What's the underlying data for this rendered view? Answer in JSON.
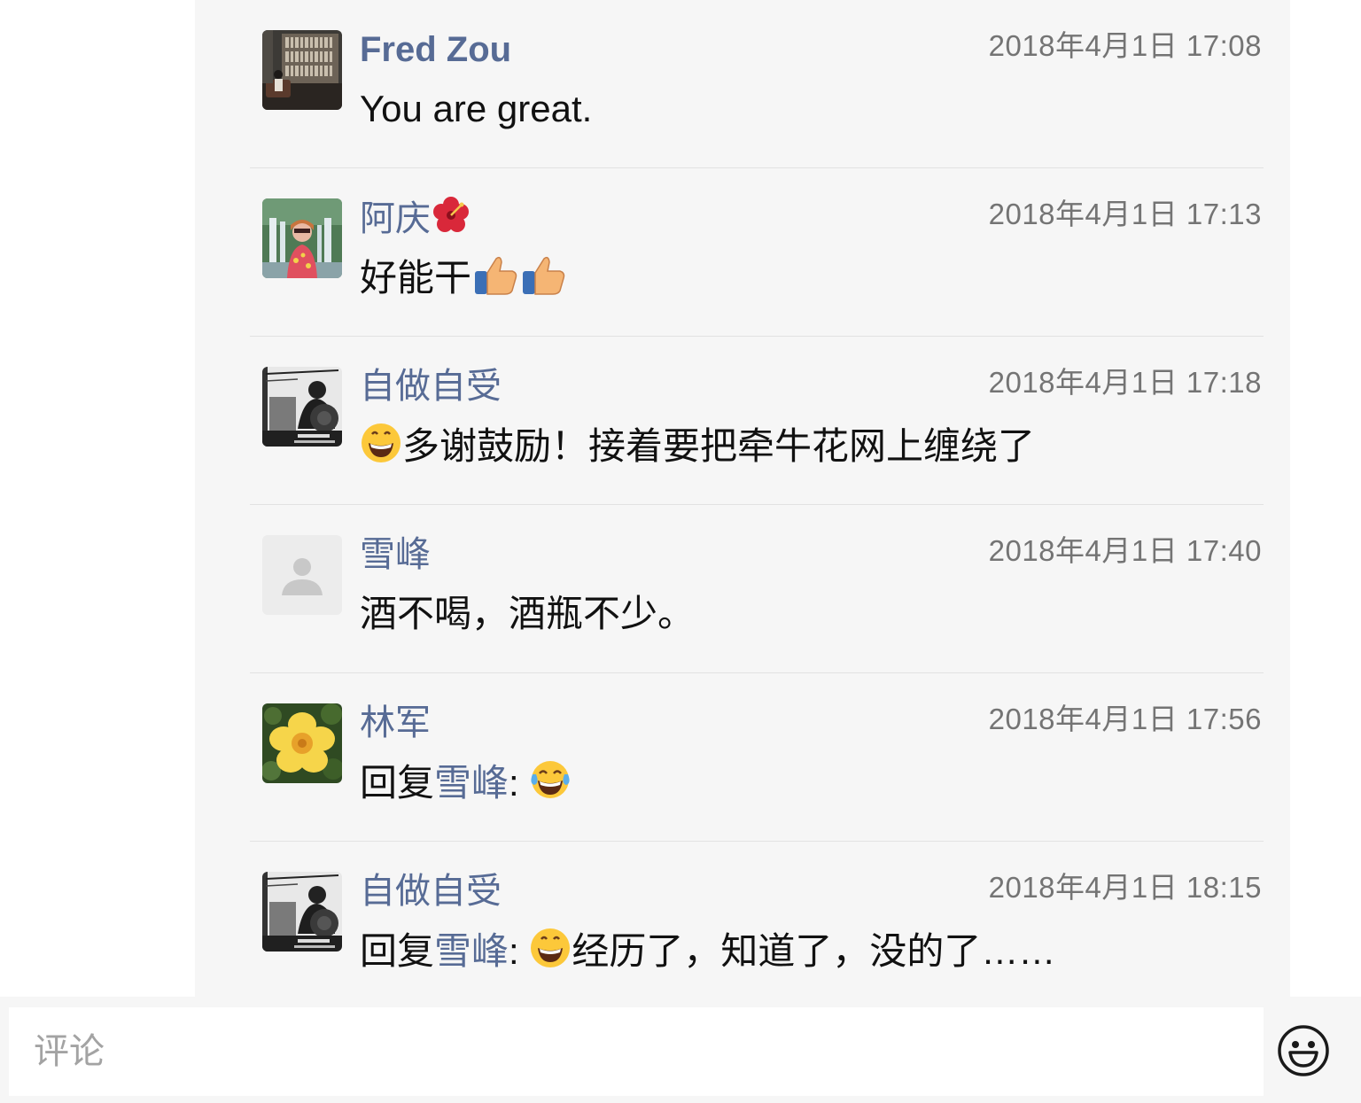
{
  "comments": [
    {
      "author": "Fred Zou",
      "time": "2018年4月1日 17:08",
      "text": "You are great.",
      "avatar": "library-photo-avatar"
    },
    {
      "author": "阿庆",
      "author_emoji": "hibiscus-emoji",
      "time": "2018年4月1日 17:13",
      "text": "好能干",
      "text_emoji": "thumbs-up-emoji ×2",
      "avatar": "waterfall-portrait-avatar"
    },
    {
      "author": "自做自受",
      "time": "2018年4月1日 17:18",
      "text": "多谢鼓励！接着要把牵牛花网上缠绕了",
      "text_emoji": "grinning-face-emoji",
      "avatar": "bw-photo-avatar"
    },
    {
      "author": "雪峰",
      "time": "2018年4月1日 17:40",
      "text": "酒不喝，酒瓶不少。",
      "avatar": "default-person-avatar"
    },
    {
      "author": "林军",
      "time": "2018年4月1日 17:56",
      "reply_prefix": "回复",
      "reply_to": "雪峰",
      "reply_colon": ":",
      "text_emoji": "tears-of-joy-emoji",
      "avatar": "yellow-flower-avatar"
    },
    {
      "author": "自做自受",
      "time": "2018年4月1日 18:15",
      "reply_prefix": "回复",
      "reply_to": "雪峰",
      "reply_colon": ":",
      "text": "经历了，知道了，没的了……",
      "text_emoji": "grinning-face-emoji",
      "avatar": "bw-photo-avatar"
    }
  ],
  "input": {
    "placeholder": "评论"
  },
  "icons": {
    "emoji_button": "smiley-icon"
  },
  "colors": {
    "author": "#576b95",
    "panel": "#f6f6f6",
    "time": "#747474"
  }
}
